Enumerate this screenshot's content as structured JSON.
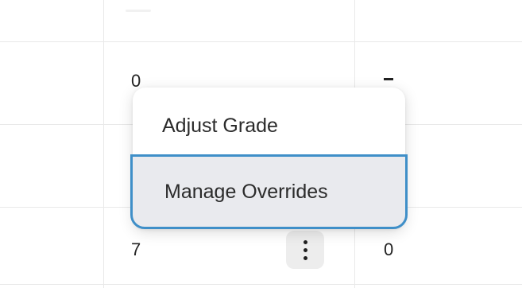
{
  "table": {
    "row1": {
      "value_a": "0",
      "value_b": "–"
    },
    "row3": {
      "value_a": "7",
      "value_b": "0"
    }
  },
  "row_actions_menu": {
    "items": [
      {
        "label": "Adjust Grade"
      },
      {
        "label": "Manage Overrides",
        "highlighted": true
      }
    ]
  },
  "kebab_button": {
    "icon": "more-vertical-icon"
  },
  "colors": {
    "highlight_border": "#3f8fc8",
    "highlight_background": "#e9eaee",
    "gridline": "#e9e9e9"
  }
}
